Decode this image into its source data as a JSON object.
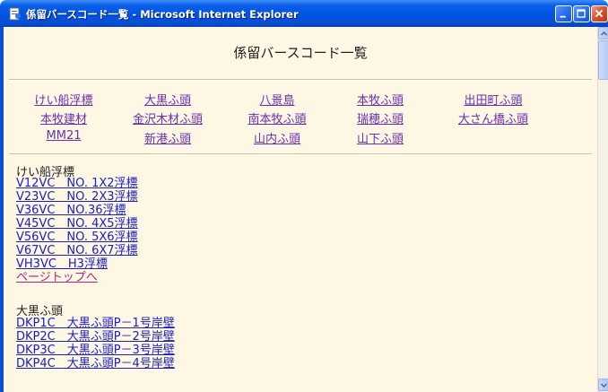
{
  "window": {
    "title": "係留バースコード一覧 - Microsoft Internet Explorer"
  },
  "page": {
    "heading": "係留バースコード一覧"
  },
  "nav": {
    "items": [
      "けい船浮標",
      "大黒ふ頭",
      "八景島",
      "本牧ふ頭",
      "出田町ふ頭",
      "本牧建材",
      "金沢木材ふ頭",
      "南本牧ふ頭",
      "瑞穂ふ頭",
      "大さん橋ふ頭",
      "MM21",
      "新港ふ頭",
      "山内ふ頭",
      "山下ふ頭"
    ]
  },
  "sections": [
    {
      "heading": "けい船浮標",
      "links": [
        "V12VC　NO. 1X2浮標",
        "V23VC　NO. 2X3浮標",
        "V36VC　NO.36浮標",
        "V45VC　NO. 4X5浮標",
        "V56VC　NO. 5X6浮標",
        "V67VC　NO. 6X7浮標",
        "VH3VC　H3浮標"
      ],
      "top_link": "ページトップへ"
    },
    {
      "heading": "大黒ふ頭",
      "links": [
        "DKP1C　大黒ふ頭P－1号岸壁",
        "DKP2C　大黒ふ頭P－2号岸壁",
        "DKP3C　大黒ふ頭P－3号岸壁",
        "DKP4C　大黒ふ頭P－4号岸壁"
      ]
    }
  ],
  "colors": {
    "titlebar": "#0054e3",
    "content_bg": "#fdf7e3",
    "visited_link": "#6b2fb0",
    "link": "#1a20c8",
    "top_link": "#b0257d"
  },
  "icons": {
    "window": "ie-page-icon",
    "minimize": "minimize-icon",
    "maximize": "maximize-icon",
    "close": "close-icon",
    "scroll_up": "scroll-up-arrow-icon",
    "scroll_down": "scroll-down-arrow-icon"
  }
}
